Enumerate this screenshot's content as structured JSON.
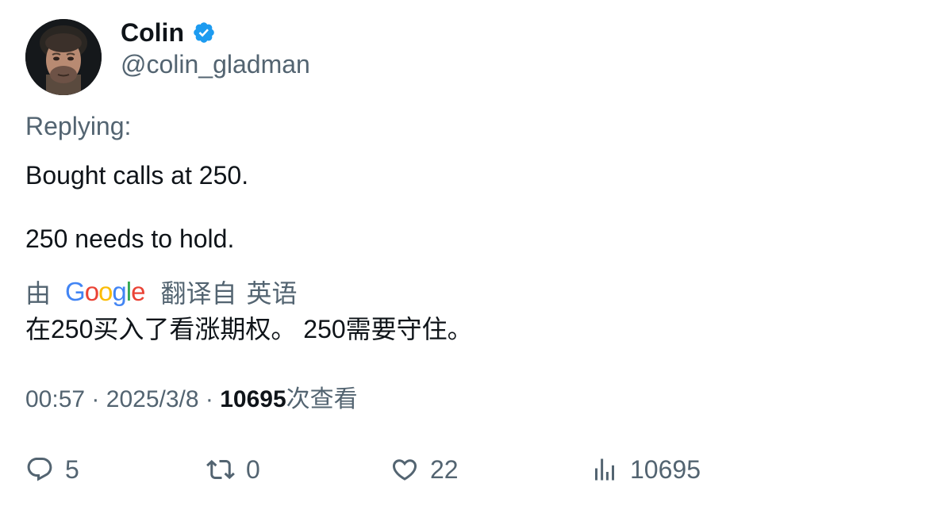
{
  "author": {
    "display_name": "Colin",
    "handle": "@colin_gladman",
    "verified_icon": "verified-badge-icon",
    "verified_color": "#1d9bf0"
  },
  "tweet": {
    "replying_label": "Replying:",
    "line_1": "Bought calls at 250.",
    "line_2": "250 needs to hold."
  },
  "translation": {
    "by_label": "由",
    "provider_logo": "Google",
    "translated_from": "翻译自",
    "source_language": "英语",
    "text": "在250买入了看涨期权。 250需要守住。"
  },
  "meta": {
    "time": "00:57",
    "separator": "·",
    "date": "2025/3/8",
    "views_count": "10695",
    "views_label": "次查看"
  },
  "actions": {
    "replies": "5",
    "retweets": "0",
    "likes": "22",
    "views": "10695"
  },
  "colors": {
    "text_primary": "#0f1419",
    "text_secondary": "#536471",
    "google_blue": "#4285F4",
    "google_red": "#EA4335",
    "google_yellow": "#FBBC05",
    "google_green": "#34A853"
  }
}
